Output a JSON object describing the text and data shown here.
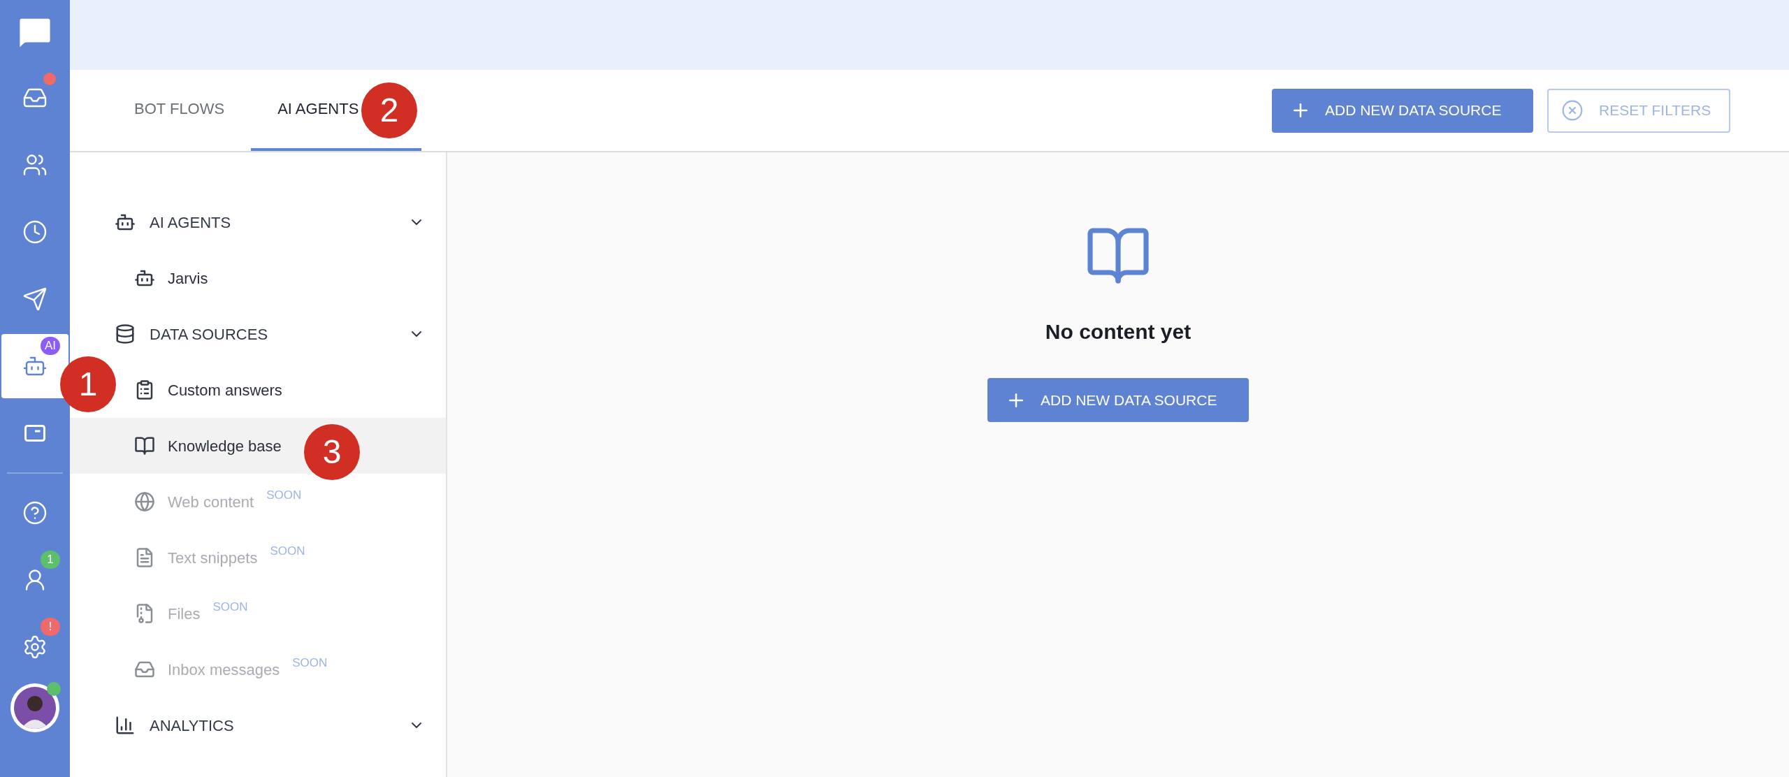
{
  "rail": {
    "items": [
      {
        "selected": false,
        "kind": "dot",
        "color": "#ef6b6b"
      },
      {
        "selected": false
      },
      {
        "selected": false
      },
      {
        "selected": false
      },
      {
        "selected": true,
        "kind": "label",
        "badge": "AI",
        "color": "#8b5cf6"
      },
      {
        "selected": false
      }
    ],
    "bottom_items": [
      {
        "selected": false
      },
      {
        "selected": false,
        "kind": "label",
        "badge": "1",
        "color": "#5cbf6b"
      },
      {
        "selected": false,
        "kind": "label",
        "badge": "!",
        "color": "#ef6b6b"
      }
    ],
    "avatar": {
      "online": true
    }
  },
  "tabs": [
    {
      "label": "BOT FLOWS",
      "selected": false
    },
    {
      "label": "AI AGENTS",
      "selected": true
    }
  ],
  "toolbar": {
    "buttons": [
      {
        "label": "ADD NEW DATA SOURCE",
        "kind": "primary",
        "disabled": false
      },
      {
        "label": "RESET FILTERS",
        "kind": "outline",
        "disabled": true
      }
    ]
  },
  "nav": {
    "sections": [
      {
        "title": "AI AGENTS",
        "expanded": true,
        "children": [
          {
            "label": "Jarvis",
            "selected": false,
            "disabled": false
          }
        ]
      },
      {
        "title": "DATA SOURCES",
        "expanded": true,
        "children": [
          {
            "label": "Custom answers",
            "selected": false,
            "disabled": false
          },
          {
            "label": "Knowledge base",
            "selected": true,
            "disabled": false
          },
          {
            "label": "Web content",
            "selected": false,
            "disabled": true,
            "tag": "SOON"
          },
          {
            "label": "Text snippets",
            "selected": false,
            "disabled": true,
            "tag": "SOON"
          },
          {
            "label": "Files",
            "selected": false,
            "disabled": true,
            "tag": "SOON"
          },
          {
            "label": "Inbox messages",
            "selected": false,
            "disabled": true,
            "tag": "SOON"
          }
        ]
      },
      {
        "title": "ANALYTICS",
        "expanded": true
      }
    ]
  },
  "empty_state": {
    "message": "No content yet",
    "button": "ADD NEW DATA SOURCE"
  },
  "annotations": [
    "1",
    "2",
    "3"
  ]
}
